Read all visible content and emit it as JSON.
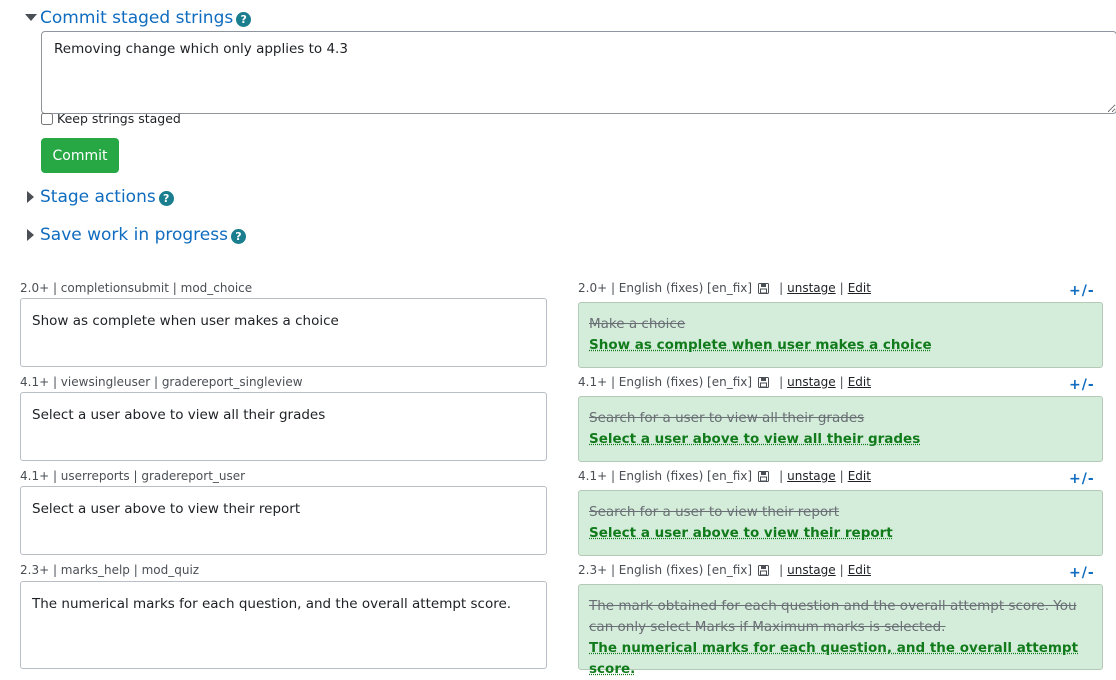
{
  "sections": {
    "commit": {
      "title": "Commit staged strings",
      "help": "?"
    },
    "stage": {
      "title": "Stage actions",
      "help": "?"
    },
    "save": {
      "title": "Save work in progress",
      "help": "?"
    }
  },
  "commit_form": {
    "message": "Removing change which only applies to 4.3",
    "keep_label": "Keep strings staged",
    "button_label": "Commit"
  },
  "strings": [
    {
      "orig_meta": "2.0+ | completionsubmit | mod_choice",
      "orig_text": "Show as complete when user makes a choice",
      "trans_meta": "2.0+ | English (fixes) [en_fix]",
      "unstage": "unstage",
      "edit": "Edit",
      "toggle": "+/-",
      "old_text": "Make a choice",
      "new_text": "Show as complete when user makes a choice"
    },
    {
      "orig_meta": "4.1+ | viewsingleuser | gradereport_singleview",
      "orig_text": "Select a user above to view all their grades",
      "trans_meta": "4.1+ | English (fixes) [en_fix]",
      "unstage": "unstage",
      "edit": "Edit",
      "toggle": "+/-",
      "old_text": "Search for a user to view all their grades",
      "new_text": "Select a user above to view all their grades"
    },
    {
      "orig_meta": "4.1+ | userreports | gradereport_user",
      "orig_text": "Select a user above to view their report",
      "trans_meta": "4.1+ | English (fixes) [en_fix]",
      "unstage": "unstage",
      "edit": "Edit",
      "toggle": "+/-",
      "old_text": "Search for a user to view their report",
      "new_text": "Select a user above to view their report"
    },
    {
      "orig_meta": "2.3+ | marks_help | mod_quiz",
      "orig_text": "The numerical marks for each question, and the overall attempt score.",
      "trans_meta": "2.3+ | English (fixes) [en_fix]",
      "unstage": "unstage",
      "edit": "Edit",
      "toggle": "+/-",
      "old_text": "The mark obtained for each question and the overall attempt score. You can only select Marks if Maximum marks is selected.",
      "new_text": "The numerical marks for each question, and the overall attempt score."
    }
  ],
  "colors": {
    "link": "#0f6cbf",
    "commit_button": "#28a745",
    "staged_bg": "#d4edda",
    "new_text": "#117b1b"
  }
}
